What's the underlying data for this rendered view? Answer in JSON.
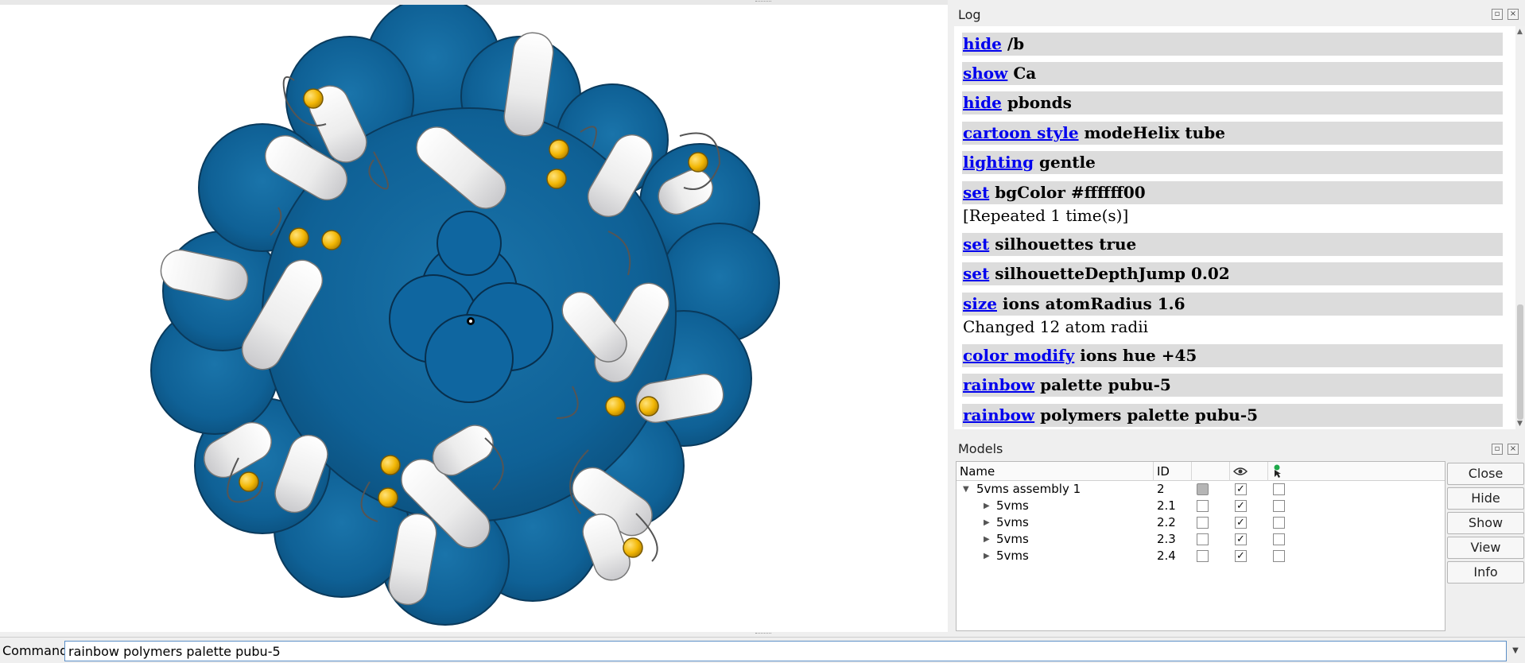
{
  "log": {
    "title": "Log",
    "entries": [
      {
        "link": "hide",
        "rest": " /b"
      },
      {
        "link": "show",
        "rest": " Ca"
      },
      {
        "link": "hide",
        "rest": " pbonds"
      },
      {
        "link": "cartoon style",
        "rest": " modeHelix tube"
      },
      {
        "link": "lighting",
        "rest": " gentle"
      },
      {
        "link": "set",
        "rest": " bgColor #ffffff00"
      },
      {
        "link": "set",
        "rest": " silhouettes true"
      },
      {
        "link": "set",
        "rest": " silhouetteDepthJump 0.02"
      },
      {
        "link": "size",
        "rest": " ions atomRadius 1.6"
      },
      {
        "link": "color modify",
        "rest": " ions hue +45"
      },
      {
        "link": "rainbow",
        "rest": " palette pubu-5"
      },
      {
        "link": "rainbow",
        "rest": " polymers palette pubu-5"
      }
    ],
    "messages": [
      "[Repeated 1 time(s)]",
      "Changed 12 atom radii"
    ]
  },
  "models": {
    "title": "Models",
    "columns": {
      "name": "Name",
      "id": "ID"
    },
    "rows": [
      {
        "name": "5vms assembly 1",
        "id": "2",
        "expanded": true,
        "shown": true
      },
      {
        "name": "5vms",
        "id": "2.1",
        "expanded": false,
        "shown": true
      },
      {
        "name": "5vms",
        "id": "2.2",
        "expanded": false,
        "shown": true
      },
      {
        "name": "5vms",
        "id": "2.3",
        "expanded": false,
        "shown": true
      },
      {
        "name": "5vms",
        "id": "2.4",
        "expanded": false,
        "shown": true
      }
    ],
    "buttons": [
      "Close",
      "Hide",
      "Show",
      "View",
      "Info"
    ]
  },
  "command": {
    "label": "Command:",
    "value": "rainbow polymers palette pubu-5"
  },
  "colors": {
    "surface": "#0e5f93",
    "helix": "#f2f2f2",
    "ion": "#f2b705",
    "link": "#0000ee"
  },
  "icons": [
    "eye-icon",
    "pointer-icon",
    "float-icon",
    "close-icon",
    "expand-arrow-icon",
    "collapse-arrow-icon",
    "dropdown-icon"
  ]
}
